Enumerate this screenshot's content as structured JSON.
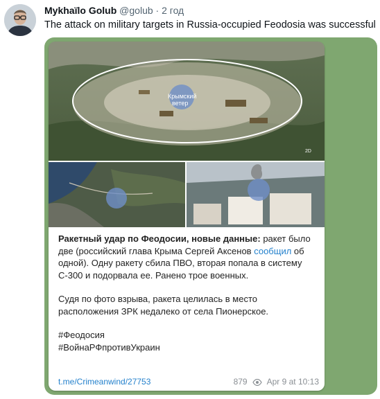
{
  "tweet": {
    "author_name": "Mykhaїlo Golub",
    "handle": "@golub",
    "separator": "·",
    "time": "2 год",
    "text": "The attack on military targets in Russia-occupied Feodosia was successful"
  },
  "telegram_post": {
    "photo_watermark_line1": "Крымский",
    "photo_watermark_line2": "ветер",
    "headline": "Ракетный удар по Феодосии, новые данные:",
    "para1_a": " ракет было две (российский глава Крыма Сергей Аксенов ",
    "para1_link": "сообщил",
    "para1_b": " об одной). Одну ракету сбила ПВО, вторая попала в систему С-300 и подорвала ее. Ранено трое военных.",
    "para2": "Судя по фото взрыва, ракета целилась в место расположения ЗРК недалеко от села Пионерское.",
    "hashtag1": "#Феодосия",
    "hashtag2": "#ВойнаРФпротивУкраин",
    "url": "t.me/Crimeanwind/27753",
    "views": "879",
    "date": "Apr 9 at 10:13",
    "map_badge": "2D"
  },
  "colors": {
    "link": "#2481cc",
    "muted": "#536471",
    "telegram_bg": "#7fa770"
  }
}
